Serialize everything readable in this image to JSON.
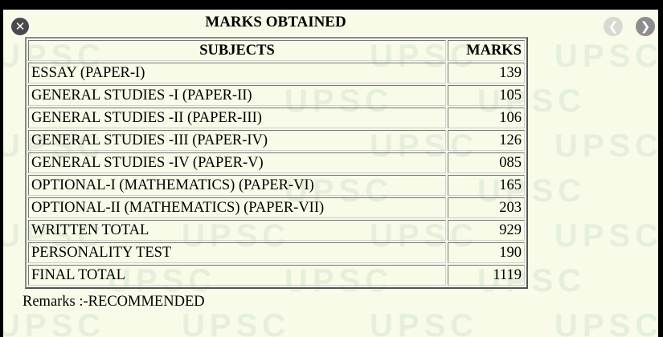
{
  "title": "MARKS OBTAINED",
  "icons": {
    "close": "close-icon",
    "prev": "chevron-left-icon",
    "next": "chevron-right-icon"
  },
  "watermark": "UPSC",
  "table": {
    "headers": [
      "SUBJECTS",
      "MARKS"
    ],
    "rows": [
      {
        "subject": "ESSAY (PAPER-I)",
        "marks": "139"
      },
      {
        "subject": "GENERAL STUDIES -I (PAPER-II)",
        "marks": "105"
      },
      {
        "subject": "GENERAL STUDIES -II (PAPER-III)",
        "marks": "106"
      },
      {
        "subject": "GENERAL STUDIES -III (PAPER-IV)",
        "marks": "126"
      },
      {
        "subject": "GENERAL STUDIES -IV (PAPER-V)",
        "marks": "085"
      },
      {
        "subject": "OPTIONAL-I (MATHEMATICS) (PAPER-VI)",
        "marks": "165"
      },
      {
        "subject": "OPTIONAL-II (MATHEMATICS) (PAPER-VII)",
        "marks": "203"
      },
      {
        "subject": "WRITTEN TOTAL",
        "marks": "929"
      },
      {
        "subject": "PERSONALITY TEST",
        "marks": "190"
      },
      {
        "subject": "FINAL TOTAL",
        "marks": "1119"
      }
    ]
  },
  "remarks": "Remarks :-RECOMMENDED",
  "colors": {
    "background": "#f7fbe8",
    "watermark": "#d9e6d2"
  }
}
